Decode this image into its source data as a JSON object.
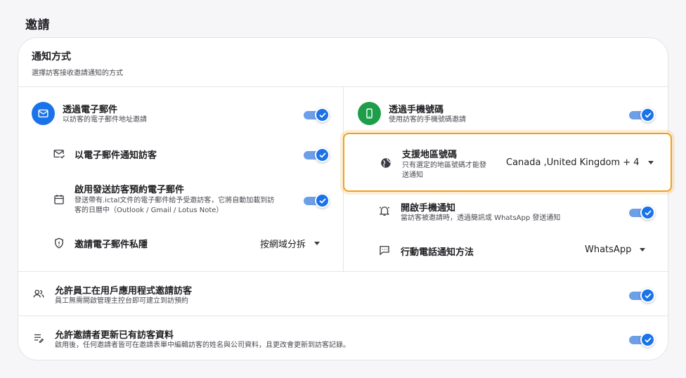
{
  "page": {
    "title": "邀請"
  },
  "card": {
    "title": "通知方式",
    "subtitle": "選擇訪客接收邀請通知的方式"
  },
  "email": {
    "title": "透過電子郵件",
    "subtitle": "以訪客的電子郵件地址邀請",
    "notify_title": "以電子郵件通知訪客",
    "booking_title": "啟用發送訪客預約電子郵件",
    "booking_sub_1": "發送帶有.ictal文件的電子郵件給予受邀訪客，它將自動加載到訪",
    "booking_sub_2": "客的日曆中（Outlook / Gmail / Lotus Note）",
    "privacy_title": "邀請電子郵件私隱",
    "privacy_value": "按網域分拆"
  },
  "phone": {
    "title": "透過手機號碼",
    "subtitle": "使用訪客的手機號碼邀請",
    "region_title": "支援地區號碼",
    "region_sub_1": "只有選定的地區號碼才能發",
    "region_sub_2": "送通知",
    "region_value": "Canada ,United Kingdom + 4",
    "notify_title": "開啟手機通知",
    "notify_sub": "當訪客被邀請時，透過簡訊或 WhatsApp 發送通知",
    "method_title": "行動電話通知方法",
    "method_value": "WhatsApp"
  },
  "employee": {
    "title": "允許員工在用戶應用程式邀請訪客",
    "subtitle": "員工無需開啟管理主控台即可建立到訪預約"
  },
  "inviter": {
    "title": "允許邀請者更新已有訪客資料",
    "subtitle": "啟用後，任何邀請者皆可在邀請表單中編輯訪客的姓名與公司資料，且更改會更新到訪客記錄。"
  },
  "toggles": {
    "email": true,
    "email_notify": true,
    "booking": true,
    "phone": true,
    "phone_notify": true,
    "employee": true,
    "inviter": true
  },
  "colors": {
    "accent": "#1a73e8",
    "email_badge": "#1a73e8",
    "phone_badge": "#1e9e4a",
    "highlight": "#f0a020"
  },
  "icons": {
    "email_badge": "mail-icon",
    "phone_badge": "phone-icon",
    "notify": "mail-check-icon",
    "booking": "calendar-icon",
    "privacy": "shield-icon",
    "region": "globe-icon",
    "phone_notify": "bell-icon",
    "method": "chat-icon",
    "employee": "people-icon",
    "inviter": "edit-list-icon"
  }
}
